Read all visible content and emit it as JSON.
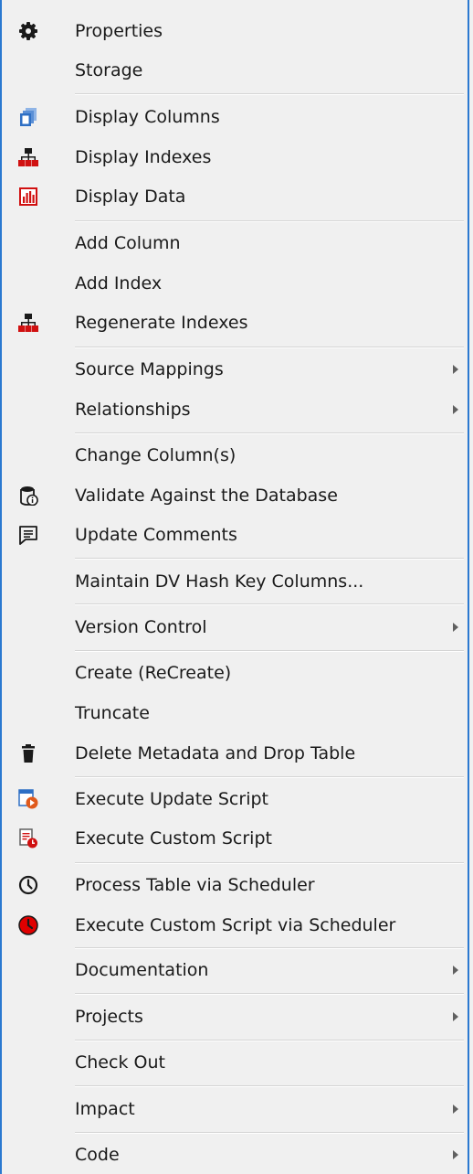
{
  "menu": {
    "items": [
      {
        "label": "Properties",
        "icon": "gear-icon"
      },
      {
        "label": "Storage"
      },
      {
        "label": "Display Columns",
        "icon": "display-columns-icon"
      },
      {
        "label": "Display Indexes",
        "icon": "indexes-hierarchy-icon"
      },
      {
        "label": "Display Data",
        "icon": "bar-chart-icon"
      },
      {
        "label": "Add Column"
      },
      {
        "label": "Add Index"
      },
      {
        "label": "Regenerate Indexes",
        "icon": "indexes-hierarchy-icon"
      },
      {
        "label": "Source Mappings",
        "submenu": true
      },
      {
        "label": "Relationships",
        "submenu": true
      },
      {
        "label": "Change Column(s)"
      },
      {
        "label": "Validate Against the Database",
        "icon": "database-info-icon"
      },
      {
        "label": "Update Comments",
        "icon": "comment-icon"
      },
      {
        "label": "Maintain DV Hash Key Columns..."
      },
      {
        "label": "Version Control",
        "submenu": true
      },
      {
        "label": "Create (ReCreate)"
      },
      {
        "label": "Truncate"
      },
      {
        "label": "Delete Metadata and Drop Table",
        "icon": "trash-icon"
      },
      {
        "label": "Execute Update Script",
        "icon": "execute-update-script-icon"
      },
      {
        "label": "Execute Custom Script",
        "icon": "execute-custom-script-icon"
      },
      {
        "label": "Process Table via Scheduler",
        "icon": "clock-icon"
      },
      {
        "label": "Execute Custom Script via Scheduler",
        "icon": "red-clock-icon"
      },
      {
        "label": "Documentation",
        "submenu": true
      },
      {
        "label": "Projects",
        "submenu": true
      },
      {
        "label": "Check Out"
      },
      {
        "label": "Impact",
        "submenu": true
      },
      {
        "label": "Code",
        "submenu": true
      }
    ]
  },
  "colors": {
    "border": "#2b79d0",
    "background": "#f0f0f0",
    "accent_blue": "#2e6fc4",
    "accent_red": "#d01010"
  }
}
